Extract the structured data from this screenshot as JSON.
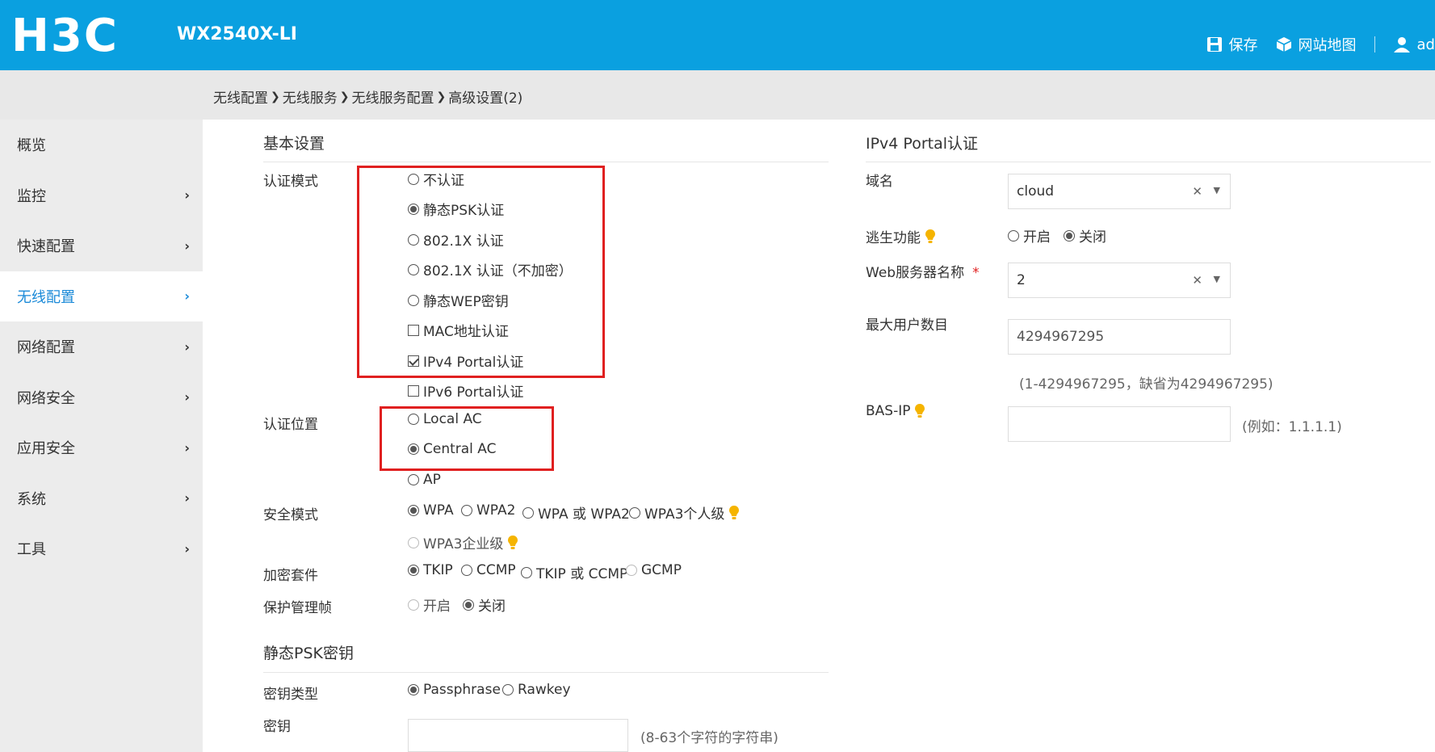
{
  "header": {
    "logo": "H3C",
    "model": "WX2540X-LI",
    "save": "保存",
    "sitemap": "网站地图",
    "user": "ad"
  },
  "breadcrumb": [
    "无线配置",
    "无线服务",
    "无线服务配置",
    "高级设置(2)"
  ],
  "sidebar": {
    "items": [
      {
        "label": "概览",
        "chevron": ""
      },
      {
        "label": "监控",
        "chevron": "›"
      },
      {
        "label": "快速配置",
        "chevron": "›"
      },
      {
        "label": "无线配置",
        "chevron": "›"
      },
      {
        "label": "网络配置",
        "chevron": "›"
      },
      {
        "label": "网络安全",
        "chevron": "›"
      },
      {
        "label": "应用安全",
        "chevron": "›"
      },
      {
        "label": "系统",
        "chevron": "›"
      },
      {
        "label": "工具",
        "chevron": "›"
      }
    ],
    "active": "无线配置"
  },
  "basic": {
    "title": "基本设置",
    "auth_mode": {
      "label": "认证模式",
      "options": [
        "不认证",
        "静态PSK认证",
        "802.1X 认证",
        "802.1X 认证（不加密）",
        "静态WEP密钥",
        "MAC地址认证",
        "IPv4 Portal认证",
        "IPv6 Portal认证"
      ],
      "selected": "静态PSK认证",
      "checked": [
        "IPv4 Portal认证"
      ]
    },
    "auth_location": {
      "label": "认证位置",
      "options": [
        "Local AC",
        "Central AC",
        "AP"
      ],
      "selected": "Central AC"
    },
    "security_mode": {
      "label": "安全模式",
      "options": [
        "WPA",
        "WPA2",
        "WPA 或 WPA2",
        "WPA3个人级",
        "WPA3企业级"
      ],
      "selected": "WPA"
    },
    "cipher": {
      "label": "加密套件",
      "options": [
        "TKIP",
        "CCMP",
        "TKIP 或 CCMP",
        "GCMP"
      ],
      "selected": "TKIP"
    },
    "pmf": {
      "label": "保护管理帧",
      "options": [
        "开启",
        "关闭"
      ],
      "selected": "关闭"
    }
  },
  "psk": {
    "title": "静态PSK密钥",
    "key_type": {
      "label": "密钥类型",
      "options": [
        "Passphrase",
        "Rawkey"
      ],
      "selected": "Passphrase"
    },
    "key": {
      "label": "密钥",
      "value": "",
      "hint": "(8-63个字符的字符串)"
    }
  },
  "portal": {
    "title": "IPv4 Portal认证",
    "domain": {
      "label": "域名",
      "value": "cloud"
    },
    "escape": {
      "label": "逃生功能",
      "options": [
        "开启",
        "关闭"
      ],
      "selected": "关闭"
    },
    "web_server": {
      "label": "Web服务器名称",
      "required": "*",
      "value": "2"
    },
    "max_users": {
      "label": "最大用户数目",
      "value": "4294967295",
      "hint": "(1-4294967295，缺省为4294967295)"
    },
    "bas_ip": {
      "label": "BAS-IP",
      "value": "",
      "hint": "(例如：1.1.1.1)"
    }
  },
  "colors": {
    "header": "#0aa0e0",
    "active_nav": "#1b8ad8",
    "highlight": "#e02020",
    "bulb": "#f5b400"
  }
}
